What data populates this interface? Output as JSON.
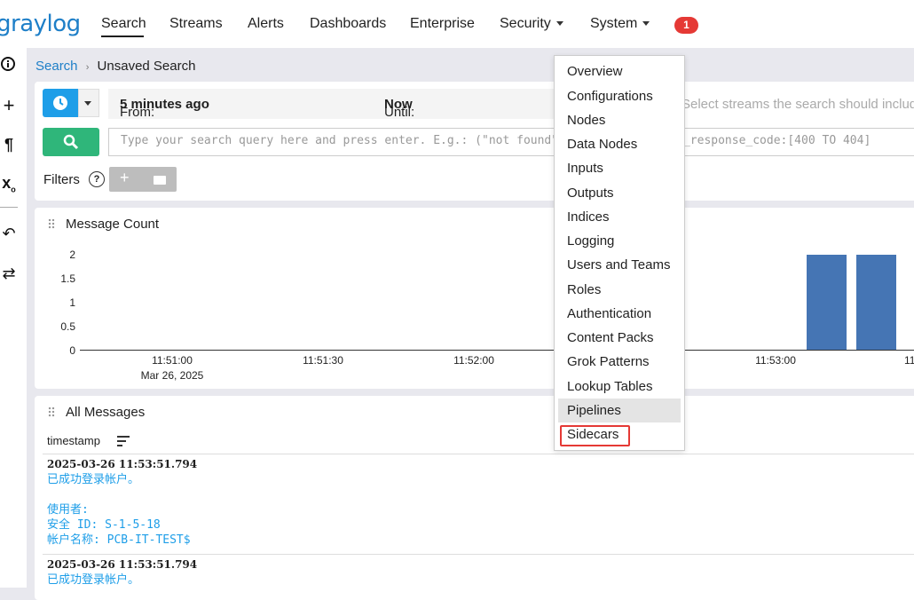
{
  "nav": {
    "logo": "graylog",
    "items": [
      "Search",
      "Streams",
      "Alerts",
      "Dashboards",
      "Enterprise",
      "Security",
      "System"
    ],
    "badge": "1"
  },
  "breadcrumb": {
    "root": "Search",
    "current": "Unsaved Search"
  },
  "search": {
    "from_label": "From:",
    "from_value": "5 minutes ago",
    "until_label": "Until:",
    "until_value": "Now",
    "streams_placeholder": "Select streams the search should includ",
    "query_placeholder": "Type your search query here and press enter. E.g.: (\"not found\" AND http) OR http_response_code:[400 TO 404]",
    "filters_label": "Filters"
  },
  "message_count": {
    "title": "Message Count"
  },
  "chart_data": {
    "type": "bar",
    "title": "",
    "y_ticks": [
      "2",
      "1.5",
      "1",
      "0.5",
      "0"
    ],
    "ylim": [
      0,
      2
    ],
    "x_ticks": [
      "11:51:00",
      "11:51:30",
      "11:52:00",
      "11:53:00",
      "11"
    ],
    "x_subtitle": "Mar 26, 2025",
    "bars": [
      {
        "time": "11:53:10",
        "value": 2
      },
      {
        "time": "11:53:20",
        "value": 2
      }
    ],
    "bar_color": "#4575b4"
  },
  "all_messages": {
    "title": "All Messages",
    "column": "timestamp",
    "messages": [
      {
        "timestamp": "2025-03-26 11:53:51.794",
        "line1": "已成功登录帐户。",
        "line2": "使用者:",
        "line3": "安全 ID: S-1-5-18",
        "line4": "帐户名称: PCB-IT-TEST$"
      },
      {
        "timestamp": "2025-03-26 11:53:51.794",
        "line1": "已成功登录帐户。"
      }
    ]
  },
  "system_menu": {
    "items": [
      "Overview",
      "Configurations",
      "Nodes",
      "Data Nodes",
      "Inputs",
      "Outputs",
      "Indices",
      "Logging",
      "Users and Teams",
      "Roles",
      "Authentication",
      "Content Packs",
      "Grok Patterns",
      "Lookup Tables",
      "Pipelines",
      "Sidecars"
    ],
    "highlighted": "Pipelines",
    "boxed": "Sidecars"
  },
  "colors": {
    "accent": "#1e9ee8",
    "search_green": "#2fb67a",
    "badge_red": "#e53935"
  }
}
